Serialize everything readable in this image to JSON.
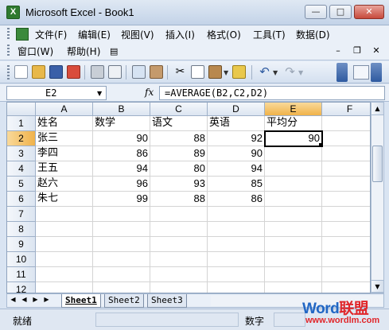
{
  "window": {
    "title": "Microsoft Excel - Book1",
    "app_icon_letter": "X"
  },
  "menu": {
    "row1": [
      {
        "name": "file",
        "label": "文件(F)"
      },
      {
        "name": "edit",
        "label": "编辑(E)"
      },
      {
        "name": "view",
        "label": "视图(V)"
      },
      {
        "name": "insert",
        "label": "插入(I)"
      },
      {
        "name": "format",
        "label": "格式(O)"
      },
      {
        "name": "tools",
        "label": "工具(T)"
      },
      {
        "name": "data",
        "label": "数据(D)"
      }
    ],
    "row2": [
      {
        "name": "window",
        "label": "窗口(W)"
      },
      {
        "name": "help",
        "label": "帮助(H)"
      }
    ]
  },
  "formula_bar": {
    "name_box": "E2",
    "fx_label": "fx",
    "formula": "=AVERAGE(B2,C2,D2)"
  },
  "grid": {
    "columns": [
      "A",
      "B",
      "C",
      "D",
      "E",
      "F"
    ],
    "active_column": "E",
    "rows": [
      1,
      2,
      3,
      4,
      5,
      6,
      7,
      8,
      9,
      10,
      11,
      12
    ],
    "active_row": 2,
    "header_row": [
      "姓名",
      "数学",
      "语文",
      "英语",
      "平均分"
    ],
    "data_rows": [
      [
        "张三",
        "90",
        "88",
        "92",
        "90"
      ],
      [
        "李四",
        "86",
        "89",
        "90",
        ""
      ],
      [
        "王五",
        "94",
        "80",
        "94",
        ""
      ],
      [
        "赵六",
        "96",
        "93",
        "85",
        ""
      ],
      [
        "朱七",
        "99",
        "88",
        "86",
        ""
      ]
    ]
  },
  "sheets": {
    "tabs": [
      "Sheet1",
      "Sheet2",
      "Sheet3"
    ],
    "active": "Sheet1"
  },
  "status": {
    "ready": "就绪",
    "mode": "数字"
  },
  "watermark": {
    "word": "Word",
    "lm": "联盟",
    "url": "www.wordlm.com"
  },
  "colors": {
    "active_header": "#f0b24a",
    "accent": "#2e5aa0",
    "watermark_blue": "#2166c4",
    "watermark_red": "#e0262a"
  }
}
